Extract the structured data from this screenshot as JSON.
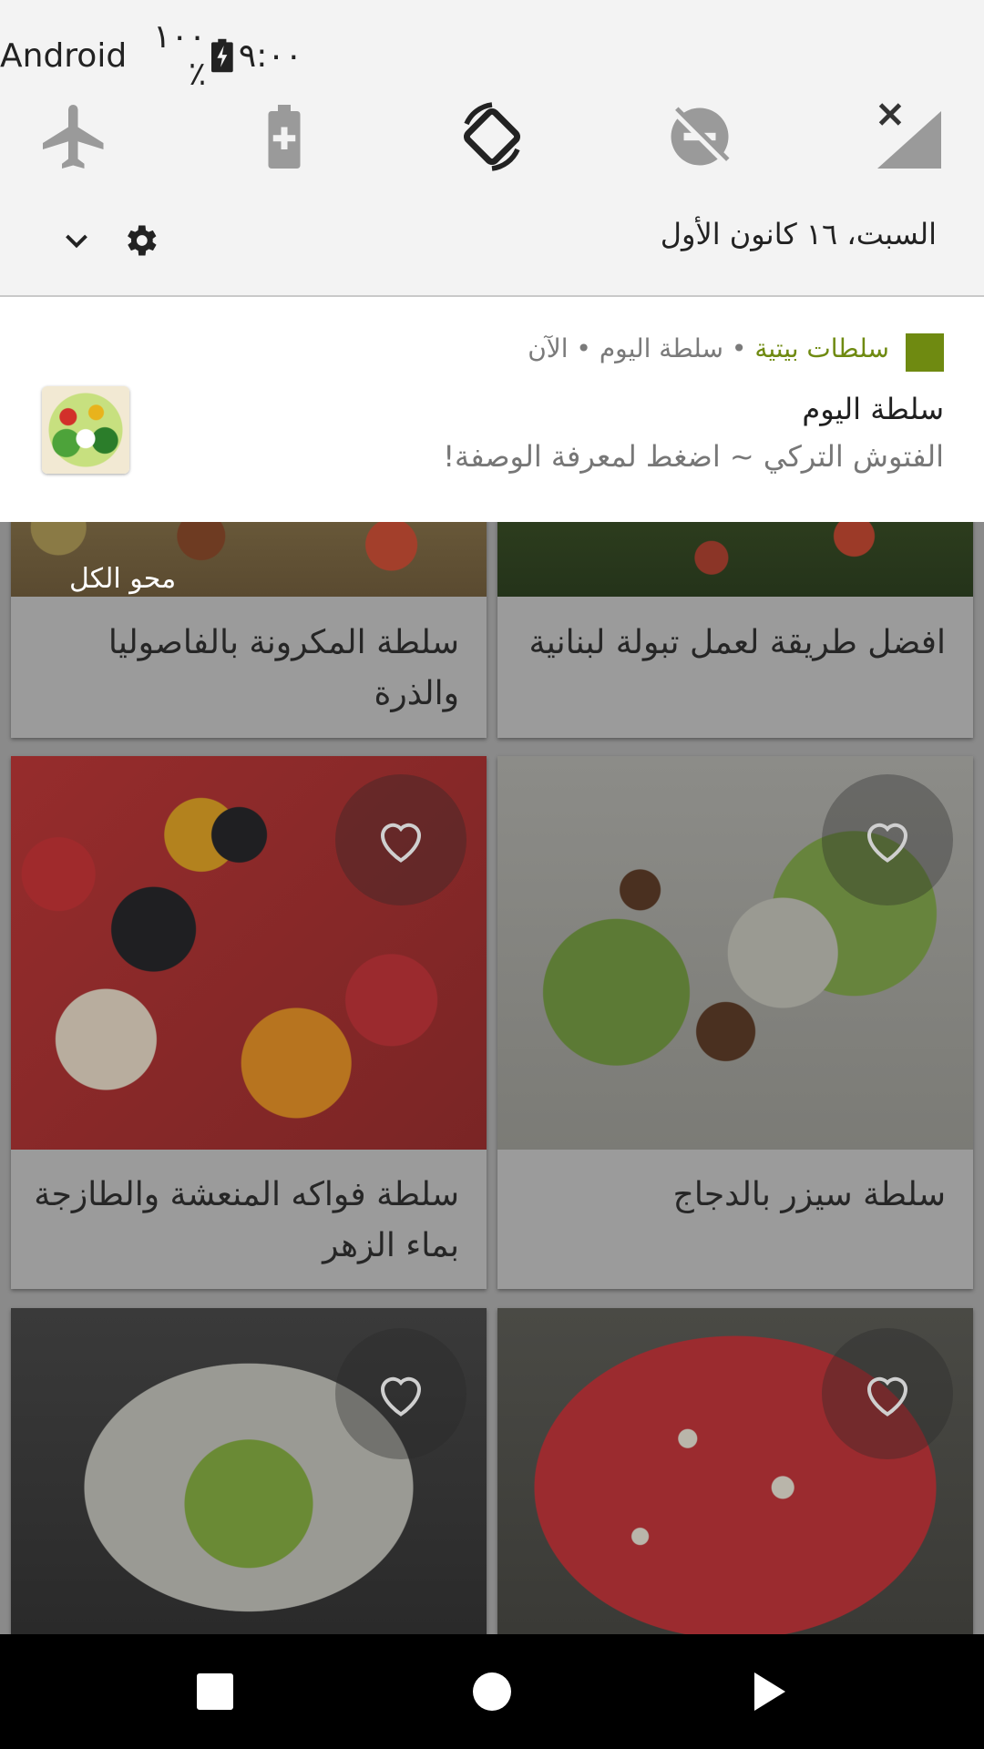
{
  "status_bar": {
    "time": "٩:٠٠",
    "battery": "١٠٠ ٪",
    "carrier": "Android"
  },
  "quick_settings": {
    "tiles": [
      {
        "name": "airplane-mode",
        "state": "off"
      },
      {
        "name": "battery-saver",
        "state": "off"
      },
      {
        "name": "auto-rotate",
        "state": "on"
      },
      {
        "name": "do-not-disturb",
        "state": "off"
      },
      {
        "name": "mobile-data",
        "state": "off"
      }
    ],
    "date": "السبت، ١٦ كانون الأول"
  },
  "notification": {
    "app_name": "سلطات بيتية",
    "header_rest": " • سلطة اليوم • الآن",
    "title": "سلطة اليوم",
    "body": "الفتوش التركي ~ اضغط لمعرفة الوصفة!",
    "accent_color": "#6f8a11"
  },
  "app": {
    "clear_all": "محو الكل",
    "cards": [
      {
        "title": "سلطة المكرونة بالفاصوليا والذرة"
      },
      {
        "title": "افضل طريقة لعمل تبولة لبنانية"
      },
      {
        "title": "سلطة فواكه المنعشة والطازجة بماء الزهر"
      },
      {
        "title": "سلطة سيزر بالدجاج"
      },
      {
        "title": ""
      },
      {
        "title": ""
      }
    ]
  }
}
